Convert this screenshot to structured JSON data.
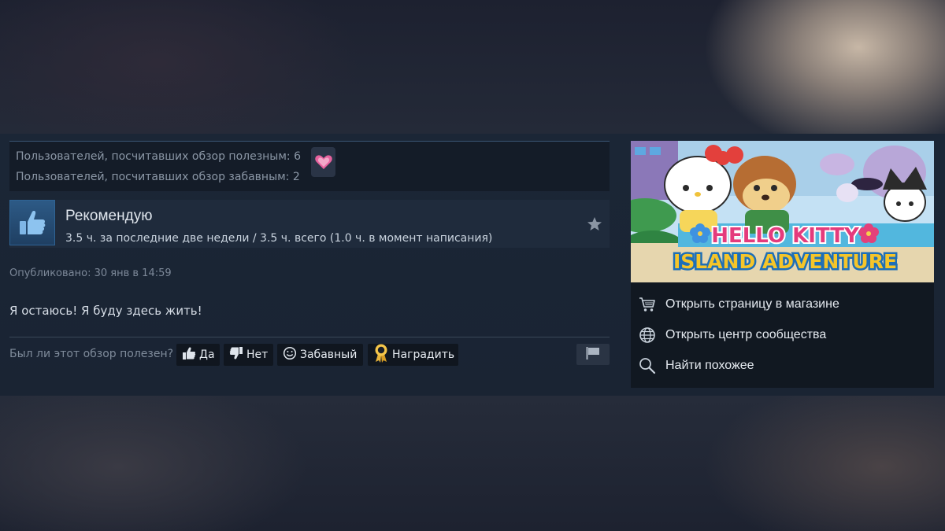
{
  "review": {
    "helpful_count_text": "Пользователей, посчитавших обзор полезным: 6",
    "funny_count_text": "Пользователей, посчитавших обзор забавным: 2",
    "award_icon": "pink-heart-award-icon",
    "verdict": "Рекомендую",
    "hours_text": "3.5 ч. за последние две недели / 3.5 ч. всего (1.0 ч. в момент написания)",
    "posted_text": "Опубликовано: 30 янв в 14:59",
    "body_text": "Я остаюсь! Я буду здесь жить!"
  },
  "vote_bar": {
    "question": "Был ли этот обзор полезен?",
    "yes_label": "Да",
    "no_label": "Нет",
    "funny_label": "Забавный",
    "award_label": "Наградить"
  },
  "sidebar": {
    "game_title_line1": "HELLO KITTY",
    "game_title_line2": "ISLAND ADVENTURE",
    "links": [
      {
        "label": "Открыть страницу в магазине",
        "icon": "cart-icon"
      },
      {
        "label": "Открыть центр сообщества",
        "icon": "globe-icon"
      },
      {
        "label": "Найти похожее",
        "icon": "search-icon"
      }
    ]
  },
  "colors": {
    "panel_bg": "#1b2636",
    "accent_blue": "#2f6495",
    "text_primary": "#e1e7ee",
    "text_muted": "#8b97a6"
  }
}
